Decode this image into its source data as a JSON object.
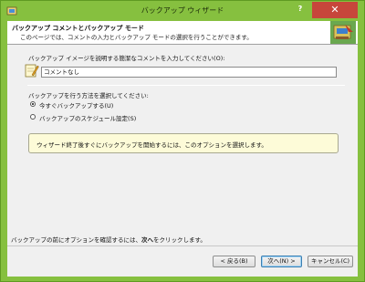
{
  "window": {
    "title": "バックアップ ウィザード",
    "help_glyph": "?",
    "close_glyph": "✕"
  },
  "header": {
    "title": "バックアップ コメントとバックアップ モード",
    "description": "このページでは、コメントの入力とバックアップ モードの選択を行うことができます。"
  },
  "comment": {
    "label": "バックアップ イメージを説明する簡潔なコメントを入力してください(O):",
    "value": "コメントなし"
  },
  "method": {
    "label": "バックアップを行う方法を選択してください:",
    "options": [
      {
        "label": "今すぐバックアップする(U)",
        "selected": true
      },
      {
        "label": "バックアップのスケジュール設定(S)",
        "selected": false
      }
    ]
  },
  "info": {
    "text": "ウィザード終了後すぐにバックアップを開始するには、このオプションを選択します。"
  },
  "footer": {
    "hint_prefix": "バックアップの前にオプションを確認するには、",
    "hint_bold": "次へ",
    "hint_suffix": "をクリックします。"
  },
  "buttons": {
    "back": "< 戻る(B)",
    "next": "次へ(N) >",
    "cancel": "キャンセル(C)"
  },
  "colors": {
    "titlebar": "#86c03f",
    "close": "#c7463b",
    "info_bg": "#fdfbd8"
  }
}
